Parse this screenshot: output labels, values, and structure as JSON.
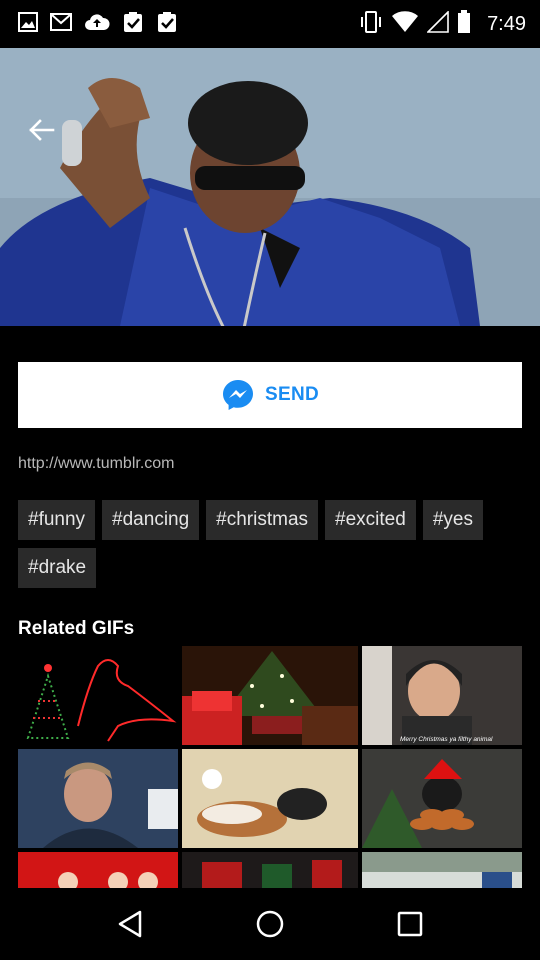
{
  "status_bar": {
    "time": "7:49",
    "left_icons": [
      "image-icon",
      "gmail-icon",
      "cloud-upload-icon",
      "clipboard-check-icon",
      "clipboard-check-icon"
    ],
    "right_icons": [
      "vibrate-icon",
      "wifi-icon",
      "signal-icon",
      "battery-icon"
    ]
  },
  "hero": {
    "description_icon": "gif-preview"
  },
  "send_button": {
    "label": "SEND",
    "color": "#1a8cf2"
  },
  "source": {
    "url": "http://www.tumblr.com"
  },
  "tags": [
    "#funny",
    "#dancing",
    "#christmas",
    "#excited",
    "#yes",
    "#drake"
  ],
  "related": {
    "title": "Related GIFs",
    "thumb_captions": {
      "merry_christmas": "Merry Christmas ya filthy animal"
    }
  }
}
